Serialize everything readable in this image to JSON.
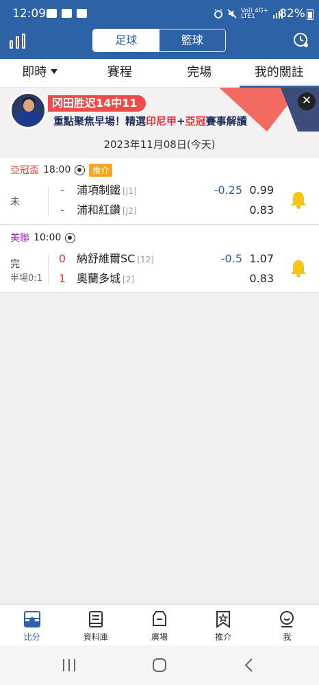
{
  "status_bar": {
    "time": "12:09",
    "battery": "82%",
    "net1": "Vol) 4G+",
    "net2": "LTE1"
  },
  "header": {
    "seg_left": "足球",
    "seg_right": "籃球"
  },
  "tabs": [
    {
      "label": "即時"
    },
    {
      "label": "賽程"
    },
    {
      "label": "完場"
    },
    {
      "label": "我的關註"
    }
  ],
  "banner": {
    "headline": "冈田胜迟14中11",
    "slogan_a": "重點聚焦早場！精選",
    "slogan_b": "印尼甲",
    "slogan_c": "+",
    "slogan_d": "亞冠",
    "slogan_e": "賽事解讀",
    "close": "✕"
  },
  "date": "2023年11月08日(今天)",
  "matches": [
    {
      "league": "亞冠盃",
      "league_color": "#d9413a",
      "time": "18:00",
      "tag": "推介",
      "status": "未",
      "half": "",
      "home": {
        "score": "-",
        "name": "浦項制鐵",
        "rank": "[J1]",
        "handicap": "-0.25",
        "odds": "0.99"
      },
      "away": {
        "score": "-",
        "name": "浦和紅鑽",
        "rank": "[J2]",
        "handicap": "",
        "odds": "0.83"
      }
    },
    {
      "league": "美聯",
      "league_color": "#9b2db3",
      "time": "10:00",
      "tag": "",
      "status": "完",
      "half": "半場0:1",
      "home": {
        "score": "0",
        "name": "納舒維爾SC",
        "rank": "[12]",
        "handicap": "-0.5",
        "odds": "1.07"
      },
      "away": {
        "score": "1",
        "name": "奧蘭多城",
        "rank": "[2]",
        "handicap": "",
        "odds": "0.83"
      }
    }
  ],
  "bottom_nav": [
    {
      "label": "比分",
      "icon": "scoreboard-icon"
    },
    {
      "label": "資料庫",
      "icon": "database-icon"
    },
    {
      "label": "廣場",
      "icon": "plaza-icon"
    },
    {
      "label": "推介",
      "icon": "recommend-icon"
    },
    {
      "label": "我",
      "icon": "profile-icon"
    }
  ],
  "colors": {
    "primary": "#2e62a6",
    "accent_red": "#e53935",
    "bell": "#f5c518",
    "tag": "#f5a623"
  }
}
